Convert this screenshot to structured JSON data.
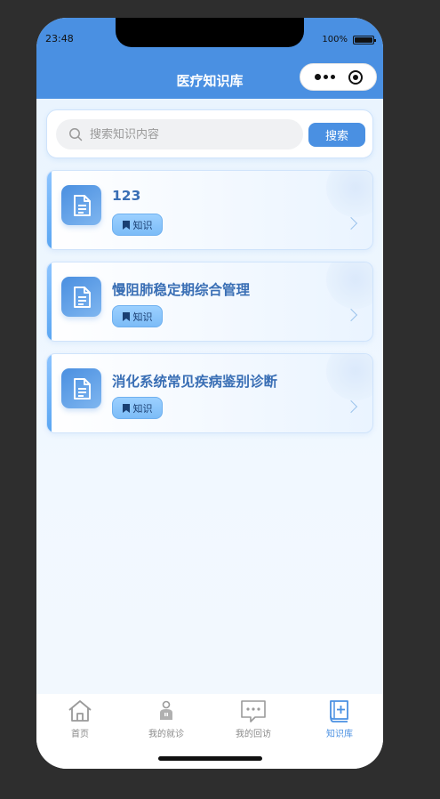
{
  "status_bar": {
    "time": "23:48",
    "battery": "100%"
  },
  "header": {
    "title": "医疗知识库"
  },
  "search": {
    "placeholder": "搜索知识内容",
    "button_label": "搜索"
  },
  "cards": [
    {
      "title": "123",
      "tag": "知识"
    },
    {
      "title": "慢阻肺稳定期综合管理",
      "tag": "知识"
    },
    {
      "title": "消化系统常见疾病鉴别诊断",
      "tag": "知识"
    }
  ],
  "tabbar": {
    "items": [
      {
        "label": "首页",
        "icon": "home-icon",
        "active": false
      },
      {
        "label": "我的就诊",
        "icon": "doctor-icon",
        "active": false
      },
      {
        "label": "我的回访",
        "icon": "chat-icon",
        "active": false
      },
      {
        "label": "知识库",
        "icon": "book-icon",
        "active": true
      }
    ]
  },
  "colors": {
    "primary": "#4a90e2",
    "background": "#eef6ff",
    "inactive": "#8a8a8a"
  }
}
